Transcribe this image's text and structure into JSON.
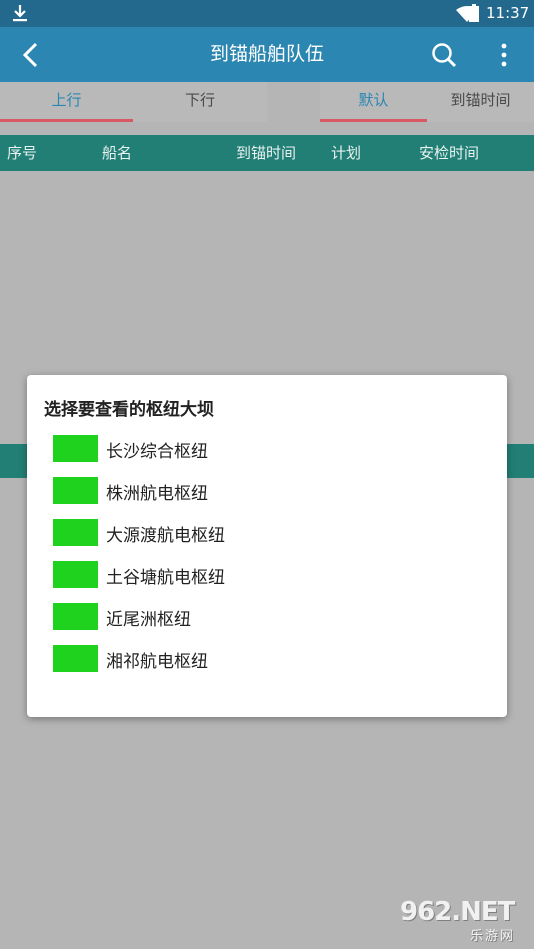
{
  "status_bar": {
    "time": "11:37"
  },
  "app_bar": {
    "title": "到锚船舶队伍"
  },
  "tabs_left": [
    {
      "label": "上行",
      "active": true
    },
    {
      "label": "下行",
      "active": false
    }
  ],
  "tabs_right": [
    {
      "label": "默认",
      "active": true
    },
    {
      "label": "到锚时间",
      "active": false
    }
  ],
  "table": {
    "columns": [
      "序号",
      "船名",
      "到锚时间",
      "计划",
      "安检时间"
    ]
  },
  "dialog": {
    "title": "选择要查看的枢纽大坝",
    "options": [
      "长沙综合枢纽",
      "株洲航电枢纽",
      "大源渡航电枢纽",
      "土谷塘航电枢纽",
      "近尾洲枢纽",
      "湘祁航电枢纽"
    ],
    "swatch_color": "#1ed21e"
  },
  "colors": {
    "status_bar": "#23688d",
    "app_bar": "#2c86b2",
    "table_header": "#227f75",
    "tab_indicator": "#d95a64",
    "overlay": "#b5b5b5"
  },
  "icons": [
    "download-icon",
    "wifi-icon",
    "battery-icon",
    "back-arrow-icon",
    "search-icon",
    "more-vert-icon"
  ],
  "watermark": {
    "brand": "962.NET",
    "sub": "乐游网"
  }
}
